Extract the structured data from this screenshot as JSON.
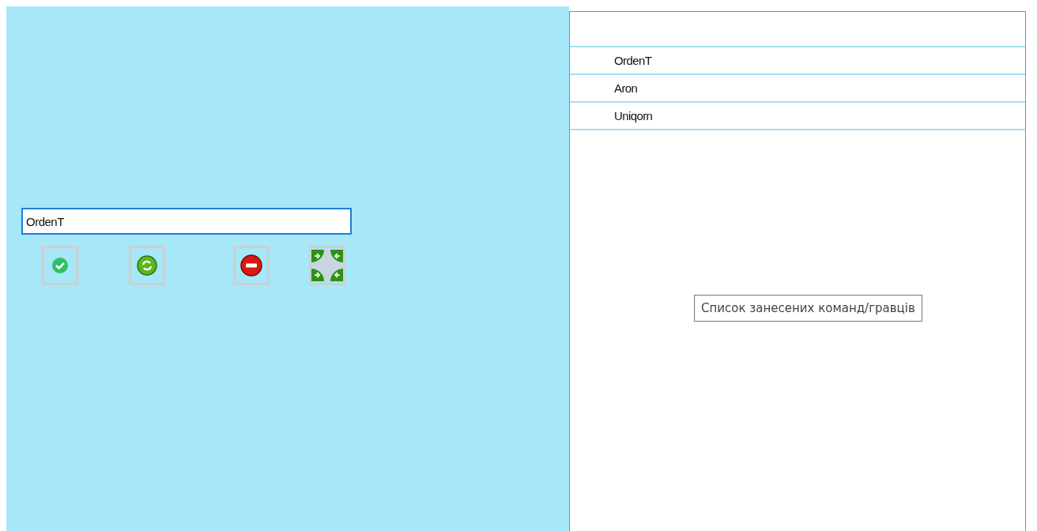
{
  "name_field": {
    "value": "OrdenT"
  },
  "buttons": [
    {
      "kind": "accept"
    },
    {
      "kind": "refresh"
    },
    {
      "kind": "delete"
    },
    {
      "kind": "expand"
    }
  ],
  "list": {
    "items": [
      "OrdenT",
      "Aron",
      "Uniqorn"
    ],
    "tooltip": "Список занесених команд/гравців"
  }
}
